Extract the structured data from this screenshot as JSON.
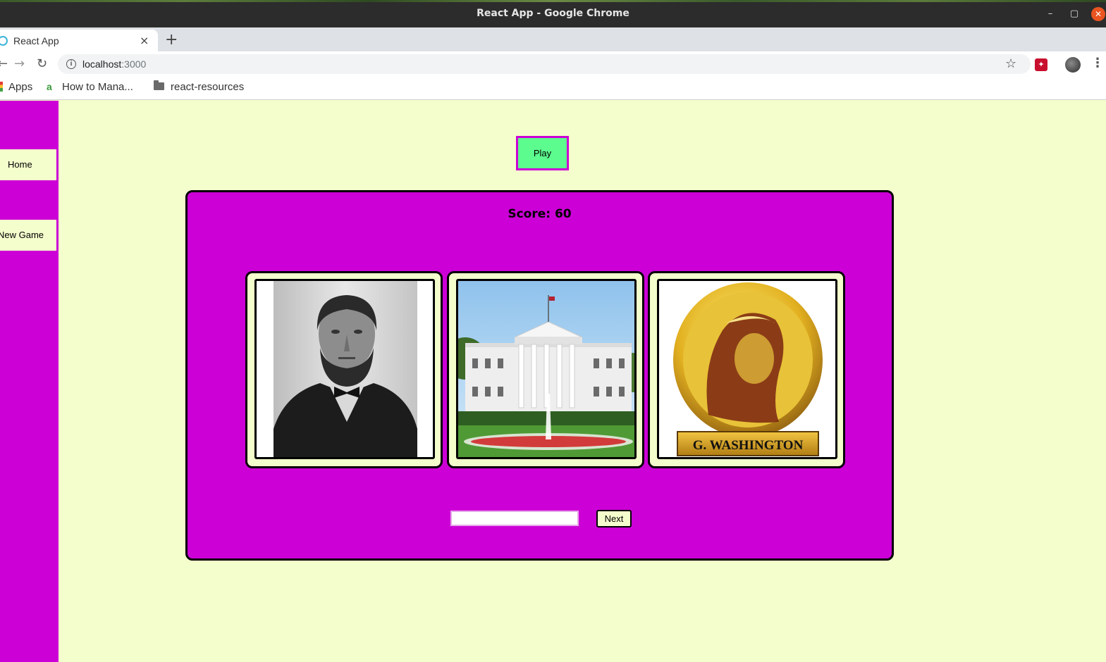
{
  "window": {
    "title": "React App - Google Chrome",
    "minimize_glyph": "–",
    "maximize_glyph": "▢",
    "close_glyph": "✕"
  },
  "tabs": [
    {
      "title": "React App",
      "close_glyph": "×",
      "icon": "react-logo-icon"
    }
  ],
  "new_tab_glyph": "+",
  "toolbar": {
    "back_glyph": "←",
    "forward_glyph": "→",
    "reload_glyph": "↻",
    "info_glyph": "i",
    "url_host": "localhost",
    "url_port": ":3000",
    "star_glyph": "☆",
    "menu_glyph": "⋮"
  },
  "bookmarks": [
    {
      "label": "Apps",
      "icon": "apps-grid-icon"
    },
    {
      "label": "How to Mana...",
      "icon": "site-favicon-icon",
      "icon_glyph": "a"
    },
    {
      "label": "react-resources",
      "icon": "folder-icon"
    }
  ],
  "sidebar": {
    "home_label": "Home",
    "new_game_label": "New Game"
  },
  "main": {
    "play_label": "Play",
    "score_label": "Score: 60",
    "cards": [
      {
        "subject": "Abraham Lincoln portrait"
      },
      {
        "subject": "The White House"
      },
      {
        "subject": "George Washington coin",
        "caption": "G. WASHINGTON"
      }
    ],
    "guess_value": "",
    "next_label": "Next"
  },
  "colors": {
    "page_bg": "#f4fdcc",
    "magenta": "#cc00d6",
    "play_green": "#5cfc8e"
  }
}
